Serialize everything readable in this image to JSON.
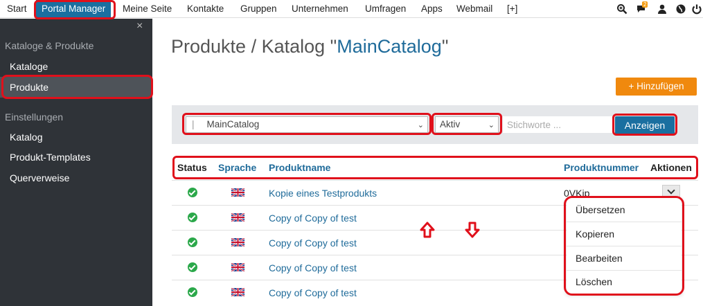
{
  "topnav": {
    "items": [
      "Start",
      "Portal Manager",
      "Meine Seite",
      "Kontakte",
      "Gruppen",
      "Unternehmen",
      "Umfragen",
      "Apps",
      "Webmail",
      "[+]"
    ],
    "active_index": 1,
    "notification_count": "2",
    "icons": [
      "search-zoom-icon",
      "chat-icon",
      "user-icon",
      "globe-icon",
      "power-icon"
    ]
  },
  "sidebar": {
    "close_glyph": "×",
    "group1": "Kataloge & Produkte",
    "group1_items": [
      "Kataloge",
      "Produkte"
    ],
    "group2": "Einstellungen",
    "group2_items": [
      "Katalog",
      "Produkt-Templates",
      "Querverweise"
    ],
    "selected": "Produkte"
  },
  "page": {
    "title_prefix": "Produkte / Katalog \"",
    "title_catalog": "MainCatalog",
    "title_suffix": "\"",
    "add_button": "+ Hinzufügen"
  },
  "filter": {
    "catalog_select": "MainCatalog",
    "status_select": "Aktiv",
    "keyword_placeholder": "Stichworte ...",
    "show_button": "Anzeigen"
  },
  "table": {
    "headers": [
      "Status",
      "Sprache",
      "Produktname",
      "Produktnummer",
      "Aktionen"
    ],
    "rows": [
      {
        "name": "Kopie eines Testprodukts",
        "number": "0VKjp"
      },
      {
        "name": "Copy of Copy of test",
        "number": ""
      },
      {
        "name": "Copy of Copy of test",
        "number": ""
      },
      {
        "name": "Copy of Copy of test",
        "number": ""
      },
      {
        "name": "Copy of Copy of test",
        "number": ""
      }
    ]
  },
  "actions_menu": [
    "Übersetzen",
    "Kopieren",
    "Bearbeiten",
    "Löschen"
  ],
  "colors": {
    "accent": "#1a6fa0",
    "link": "#1f6b9a",
    "orange": "#f0890e",
    "annotation": "#e0101b",
    "sidebar_bg": "#2f3338",
    "status_ok": "#2ba84a"
  }
}
